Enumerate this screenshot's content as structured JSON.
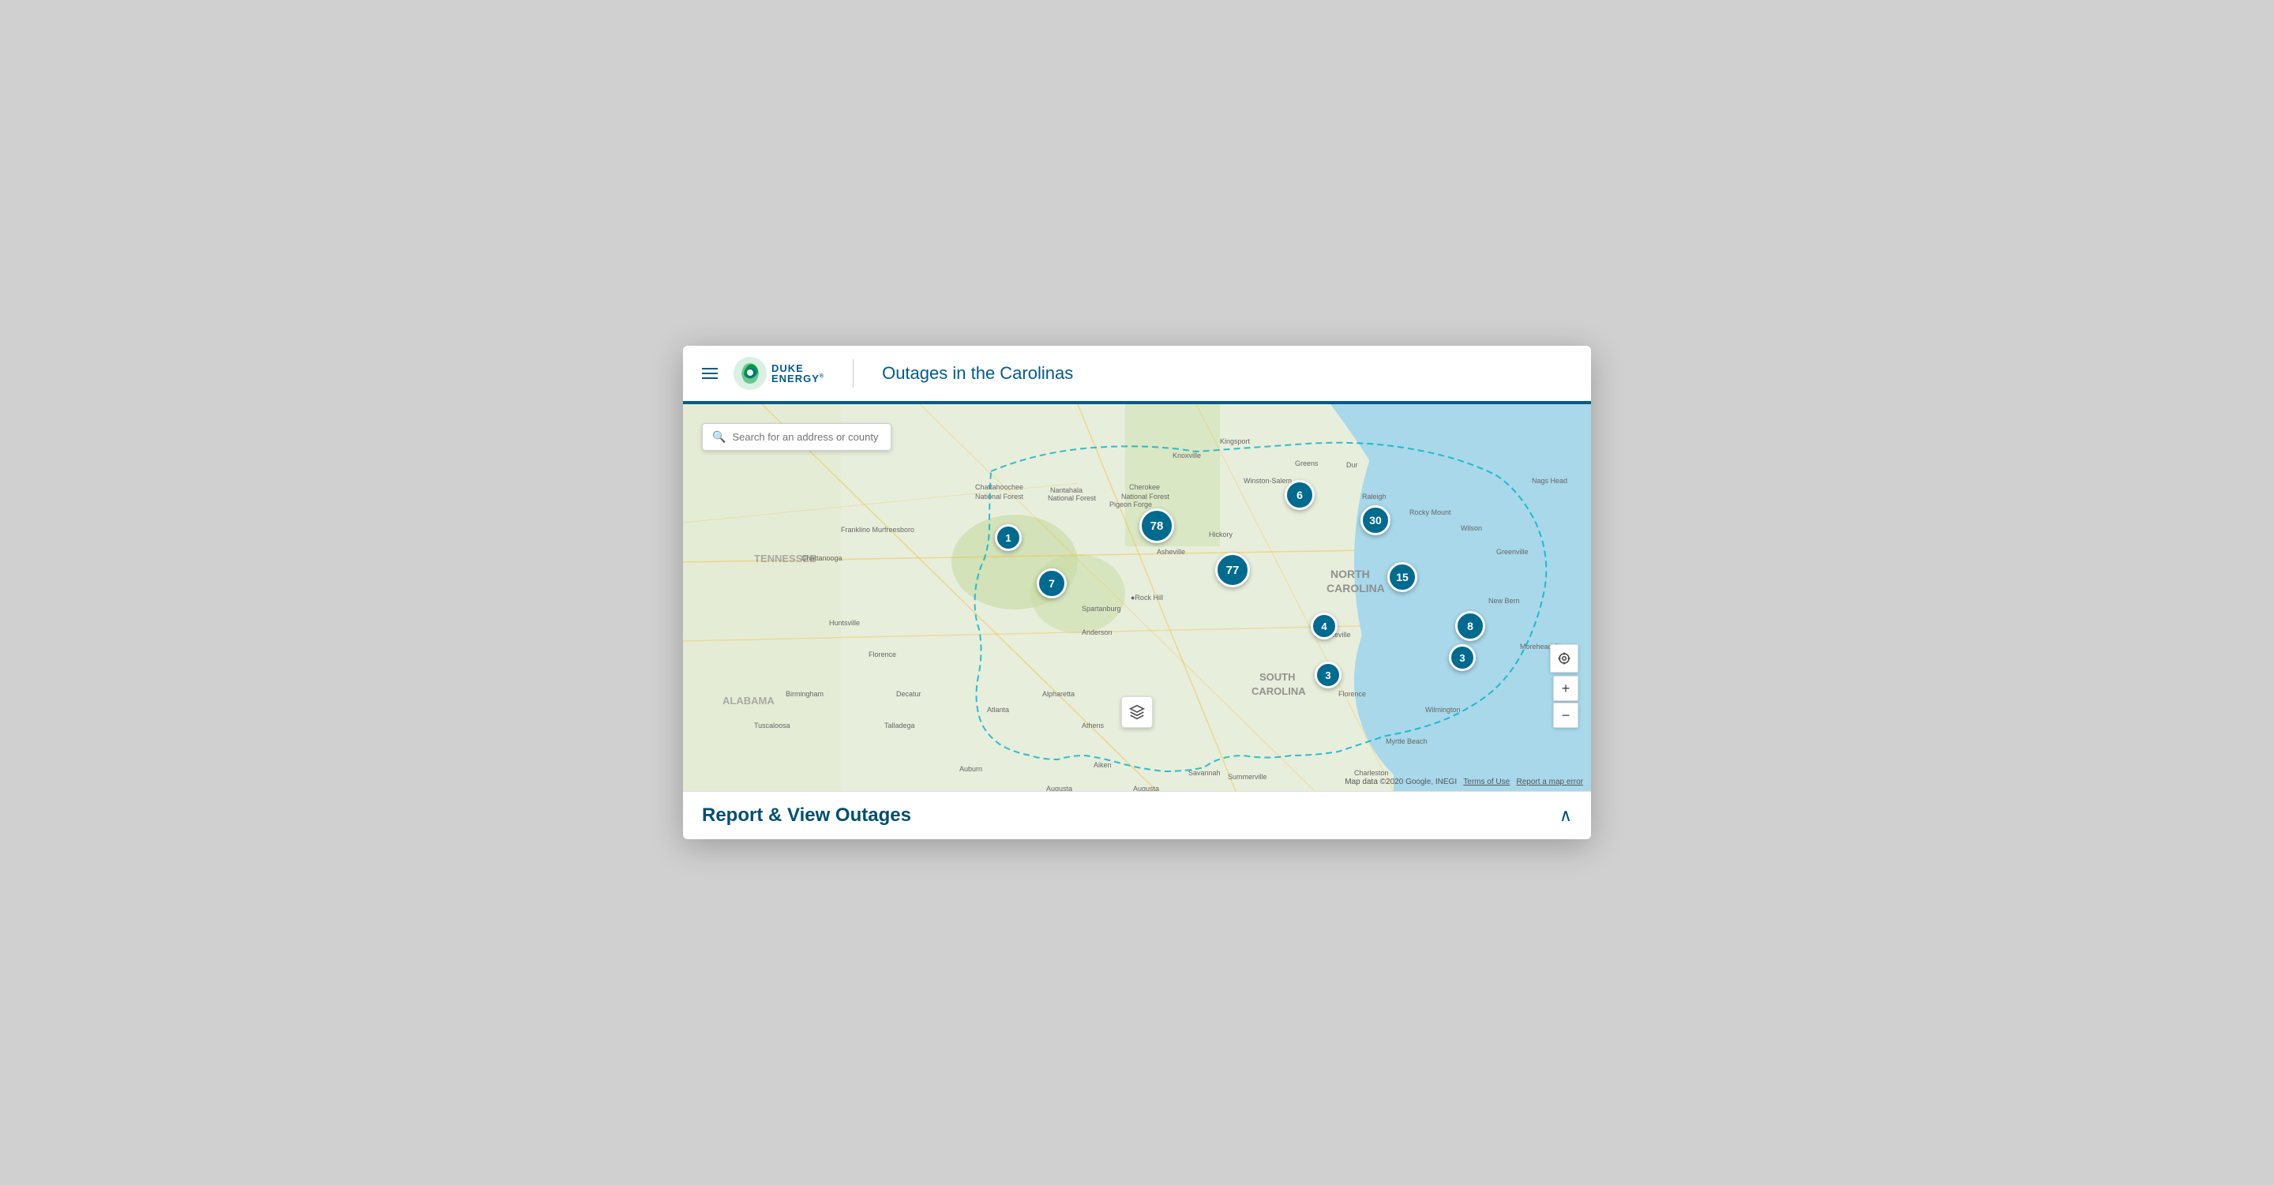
{
  "header": {
    "menu_label": "Menu",
    "logo_duke": "DUKE",
    "logo_energy": "ENERGY",
    "logo_reg": "®",
    "page_title": "Outages in the Carolinas"
  },
  "search": {
    "placeholder": "Search for an address or county"
  },
  "markers": [
    {
      "id": "m1",
      "label": "1",
      "left": "395",
      "top": "148",
      "size": "sm"
    },
    {
      "id": "m7",
      "label": "7",
      "left": "465",
      "top": "207",
      "size": "md"
    },
    {
      "id": "m78",
      "label": "78",
      "left": "590",
      "top": "130",
      "size": "lg"
    },
    {
      "id": "m6",
      "label": "6",
      "left": "769",
      "top": "98",
      "size": "md"
    },
    {
      "id": "m30",
      "label": "30",
      "left": "870",
      "top": "130",
      "size": "md"
    },
    {
      "id": "m77",
      "label": "77",
      "left": "688",
      "top": "196",
      "size": "lg"
    },
    {
      "id": "m15",
      "label": "15",
      "left": "900",
      "top": "208",
      "size": "md"
    },
    {
      "id": "m4",
      "label": "4",
      "left": "800",
      "top": "268",
      "size": "sm"
    },
    {
      "id": "m8",
      "label": "8",
      "left": "986",
      "top": "268",
      "size": "md"
    },
    {
      "id": "m3a",
      "label": "3",
      "left": "804",
      "top": "332",
      "size": "sm"
    },
    {
      "id": "m3b",
      "label": "3",
      "left": "974",
      "top": "310",
      "size": "sm"
    }
  ],
  "bottom_bar": {
    "title": "Report & View Outages",
    "chevron": "^"
  },
  "map_attribution": {
    "text": "Map data ©2020 Google, INEGI",
    "terms": "Terms of Use",
    "report": "Report a map error"
  },
  "zoom": {
    "plus": "+",
    "minus": "−"
  }
}
